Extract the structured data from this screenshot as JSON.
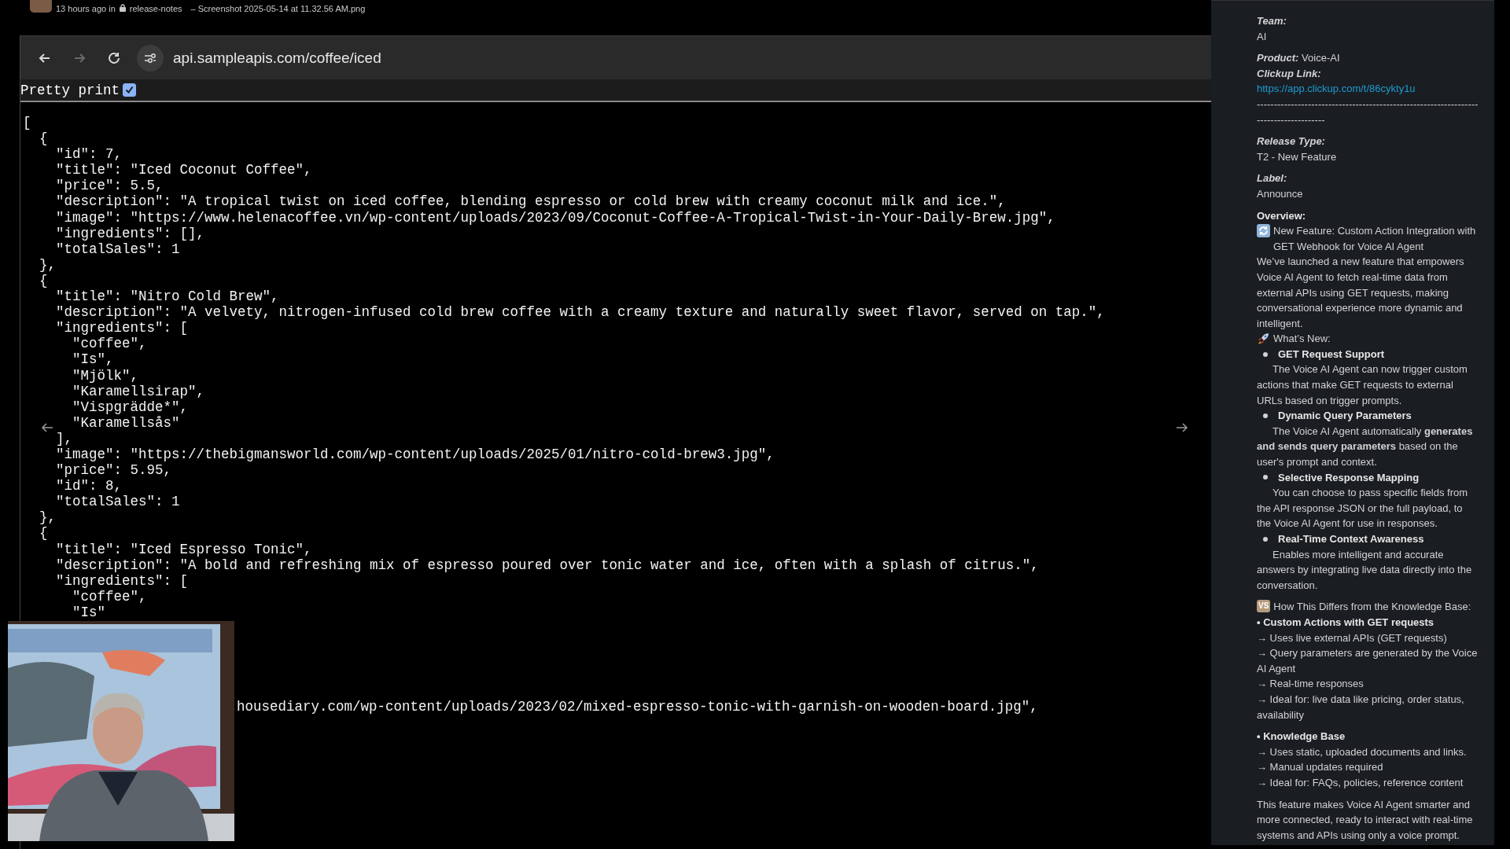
{
  "post_meta": {
    "time": "13 hours ago in",
    "channel": "release-notes",
    "file": "– Screenshot 2025-05-14 at 11.32.56 AM.png"
  },
  "browser": {
    "back": {
      "disabled": false
    },
    "forward": {
      "disabled": true
    },
    "url": "api.sampleapis.com/coffee/iced",
    "pretty_print": {
      "label": "Pretty print",
      "checked": true
    },
    "lines": [
      "[",
      "  {",
      "    \"id\": 7,",
      "    \"title\": \"Iced Coconut Coffee\",",
      "    \"price\": 5.5,",
      "    \"description\": \"A tropical twist on iced coffee, blending espresso or cold brew with creamy coconut milk and ice.\",",
      "    \"image\": \"https://www.helenacoffee.vn/wp-content/uploads/2023/09/Coconut-Coffee-A-Tropical-Twist-in-Your-Daily-Brew.jpg\",",
      "    \"ingredients\": [],",
      "    \"totalSales\": 1",
      "  },",
      "  {",
      "    \"title\": \"Nitro Cold Brew\",",
      "    \"description\": \"A velvety, nitrogen-infused cold brew coffee with a creamy texture and naturally sweet flavor, served on tap.\",",
      "    \"ingredients\": [",
      "      \"coffee\",",
      "      \"Is\",",
      "      \"Mjölk\",",
      "      \"Karamellsirap\",",
      "      \"Vispgrädde*\",",
      "      \"Karamellsås\"",
      "    ],",
      "    \"image\": \"https://thebigmansworld.com/wp-content/uploads/2025/01/nitro-cold-brew3.jpg\",",
      "    \"price\": 5.95,",
      "    \"id\": 8,",
      "    \"totalSales\": 1",
      "  },",
      "  {",
      "    \"title\": \"Iced Espresso Tonic\",",
      "    \"description\": \"A bold and refreshing mix of espresso poured over tonic water and ice, often with a splash of citrus.\",",
      "    \"ingredients\": [",
      "      \"coffee\",",
      "      \"Is\""
    ],
    "tail_line": "housediary.com/wp-content/uploads/2023/02/mixed-espresso-tonic-with-garnish-on-wooden-board.jpg\","
  },
  "sidebar": {
    "sections": [
      [
        {
          "kind": "label",
          "text": "Team:"
        },
        {
          "kind": "text",
          "text": "AI"
        }
      ],
      [
        {
          "kind": "label_value",
          "label": "Product:",
          "text": "Voice-AI"
        },
        {
          "kind": "label",
          "text": "Clickup Link:"
        },
        {
          "kind": "link",
          "text": "https://app.clickup.com/t/86cykty1u"
        },
        {
          "kind": "dashes",
          "text": "-------------------------------------------------------------------------------------"
        }
      ],
      [
        {
          "kind": "label",
          "text": "Release Type:"
        },
        {
          "kind": "text",
          "text": "T2 - New Feature"
        }
      ],
      [
        {
          "kind": "label",
          "text": "Label:"
        },
        {
          "kind": "text",
          "text": "Announce"
        }
      ],
      [
        {
          "kind": "heading",
          "text": "Overview:"
        },
        {
          "kind": "announce",
          "text": "New Feature: Custom Action Integration with GET Webhook for Voice AI Agent"
        },
        {
          "kind": "text",
          "text": "We’ve launched a new feature that empowers Voice AI Agent to fetch real-time data from external APIs using GET requests, making conversational experience more dynamic and intelligent."
        },
        {
          "kind": "whats_new",
          "text": "What’s New:"
        },
        {
          "kind": "bullet",
          "title": "GET Request Support",
          "text": "The Voice AI Agent can now trigger custom actions that make GET requests to external URLs based on trigger prompts."
        },
        {
          "kind": "bullet",
          "title": "Dynamic Query Parameters",
          "text": "The Voice AI Agent automatically **generates and sends query parameters** based on the user's prompt and context."
        },
        {
          "kind": "bullet",
          "title": "Selective Response Mapping",
          "text": "You can choose to pass specific fields from the API response JSON or the full payload, to the Voice AI Agent for use in responses."
        },
        {
          "kind": "bullet",
          "title": "Real-Time Context Awareness",
          "text": "Enables more intelligent and accurate answers by integrating live data directly into the conversation."
        }
      ],
      [
        {
          "kind": "compare",
          "badge": "VS",
          "text": "How This Differs from the Knowledge Base:"
        },
        {
          "kind": "bold",
          "text": "• Custom Actions with GET requests"
        },
        {
          "kind": "text",
          "text": " → Uses live external APIs (GET requests)"
        },
        {
          "kind": "text",
          "text": " → Query parameters are generated by the Voice AI Agent"
        },
        {
          "kind": "text",
          "text": " → Real-time responses"
        },
        {
          "kind": "text",
          "text": " → Ideal for: live data like pricing, order status, availability"
        }
      ],
      [
        {
          "kind": "bold",
          "text": "• Knowledge Base"
        },
        {
          "kind": "text",
          "text": " → Uses static, uploaded documents and links."
        },
        {
          "kind": "text",
          "text": " → Manual updates required"
        },
        {
          "kind": "text",
          "text": " → Ideal for: FAQs, policies, reference content"
        }
      ],
      [
        {
          "kind": "text",
          "text": "This feature makes Voice AI Agent smarter and more connected, ready to interact with real-time systems and APIs using only a voice prompt."
        }
      ]
    ]
  }
}
